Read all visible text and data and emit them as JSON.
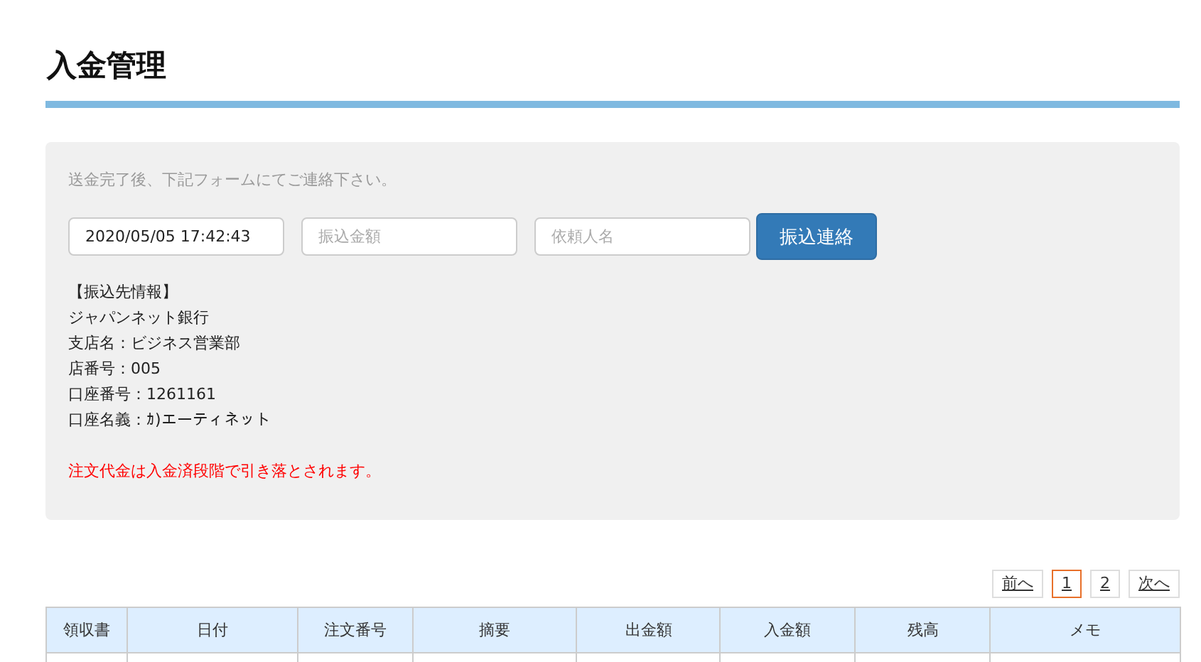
{
  "page_title": "入金管理",
  "form": {
    "note": "送金完了後、下記フォームにてご連絡下さい。",
    "fields": [
      {
        "value": "2020/05/05 17:42:43"
      },
      {
        "placeholder": "振込金額"
      },
      {
        "placeholder": "依頼人名"
      }
    ],
    "submit": "振込連絡",
    "bank_info": [
      "【振込先情報】",
      "ジャパンネット銀行",
      "支店名：ビジネス営業部",
      "店番号：005",
      "口座番号：1261161",
      "口座名義：ｶ)エーティネット"
    ],
    "warning": "注文代金は入金済段階で引き落とされます。"
  },
  "pagination": [
    {
      "label": "前へ",
      "kind": "nav"
    },
    {
      "label": "1",
      "kind": "page",
      "selected": true
    },
    {
      "label": "2",
      "kind": "page",
      "selected": false
    },
    {
      "label": "次へ",
      "kind": "nav"
    }
  ],
  "table": {
    "columns": [
      "領収書",
      "日付",
      "注文番号",
      "摘要",
      "出金額",
      "入金額",
      "残高",
      "メモ"
    ]
  }
}
